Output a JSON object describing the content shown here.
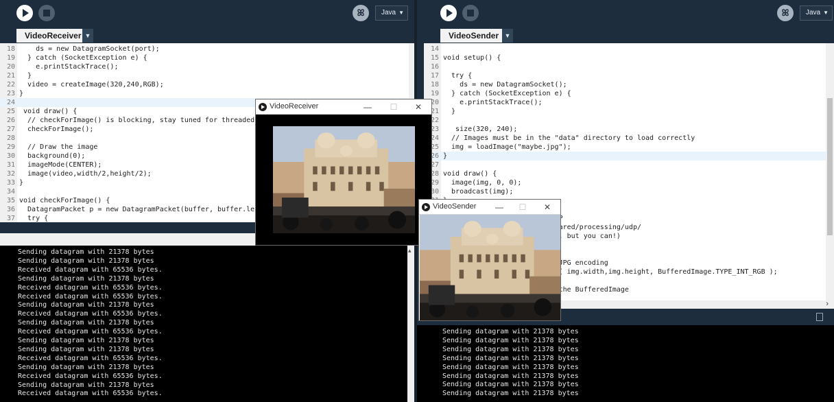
{
  "receiver": {
    "mode_label": "Java",
    "debug_icon_glyph": "ꕤ",
    "tab_label": "VideoReceiver",
    "code": [
      {
        "n": "18",
        "t": "    ds = new DatagramSocket(port);"
      },
      {
        "n": "19",
        "t": "  } catch (SocketException e) {"
      },
      {
        "n": "20",
        "t": "    e.printStackTrace();"
      },
      {
        "n": "21",
        "t": "  }"
      },
      {
        "n": "22",
        "t": "  video = createImage(320,240,RGB);"
      },
      {
        "n": "23",
        "t": "}"
      },
      {
        "n": "24",
        "t": ""
      },
      {
        "n": "25",
        "t": " void draw() {"
      },
      {
        "n": "26",
        "t": "  // checkForImage() is blocking, stay tuned for threaded exa"
      },
      {
        "n": "27",
        "t": "  checkForImage();"
      },
      {
        "n": "28",
        "t": ""
      },
      {
        "n": "29",
        "t": "  // Draw the image"
      },
      {
        "n": "30",
        "t": "  background(0);"
      },
      {
        "n": "31",
        "t": "  imageMode(CENTER);"
      },
      {
        "n": "32",
        "t": "  image(video,width/2,height/2);"
      },
      {
        "n": "33",
        "t": "}"
      },
      {
        "n": "34",
        "t": ""
      },
      {
        "n": "35",
        "t": "void checkForImage() {"
      },
      {
        "n": "36",
        "t": "  DatagramPacket p = new DatagramPacket(buffer, buffer.length"
      },
      {
        "n": "37",
        "t": "  try {"
      }
    ],
    "console": [
      "Sending datagram with 21378 bytes",
      "Sending datagram with 21378 bytes",
      "Received datagram with 65536 bytes.",
      "Sending datagram with 21378 bytes",
      "Received datagram with 65536 bytes.",
      "Received datagram with 65536 bytes.",
      "Sending datagram with 21378 bytes",
      "Received datagram with 65536 bytes.",
      "Sending datagram with 21378 bytes",
      "Received datagram with 65536 bytes.",
      "Sending datagram with 21378 bytes",
      "Sending datagram with 21378 bytes",
      "Received datagram with 65536 bytes.",
      "Sending datagram with 21378 bytes",
      "Received datagram with 65536 bytes.",
      "Sending datagram with 21378 bytes",
      "Received datagram with 65536 bytes."
    ]
  },
  "sender": {
    "mode_label": "Java",
    "debug_icon_glyph": "ꕤ",
    "tab_label": "VideoSender",
    "code": [
      {
        "n": "14",
        "t": ""
      },
      {
        "n": "15",
        "t": "void setup() {"
      },
      {
        "n": "16",
        "t": ""
      },
      {
        "n": "17",
        "t": "  try {"
      },
      {
        "n": "18",
        "t": "    ds = new DatagramSocket();"
      },
      {
        "n": "19",
        "t": "  } catch (SocketException e) {"
      },
      {
        "n": "20",
        "t": "    e.printStackTrace();"
      },
      {
        "n": "21",
        "t": "  }"
      },
      {
        "n": "22",
        "t": ""
      },
      {
        "n": "23",
        "t": "   size(320, 240);"
      },
      {
        "n": "24",
        "t": "  // Images must be in the \"data\" directory to load correctly"
      },
      {
        "n": "25",
        "t": "  img = loadImage(\"maybe.jpg\");"
      },
      {
        "n": "26",
        "t": "}"
      },
      {
        "n": "27",
        "t": ""
      },
      {
        "n": "28",
        "t": "void draw() {"
      },
      {
        "n": "29",
        "t": "  image(img, 0, 0);"
      },
      {
        "n": "30",
        "t": "  broadcast(img);"
      },
      {
        "n": "31",
        "t": "}"
      },
      {
        "n": "",
        "t": ""
      },
      {
        "n": "",
        "t": "                  ge over UDP"
      },
      {
        "n": "",
        "t": "                  baa.net/shared/processing/udp/"
      },
      {
        "n": "",
        "t": "                  he library, but you can!)"
      },
      {
        "n": "",
        "t": ""
      },
      {
        "n": "",
        "t": ""
      },
      {
        "n": "",
        "t": "                  to do the JPG encoding"
      },
      {
        "n": "",
        "t": "                  feredImage( img.width,img.height, BufferedImage.TYPE_INT_RGB );"
      },
      {
        "n": "",
        "t": ""
      },
      {
        "n": "",
        "t": "                  lFrame to the BufferedImage"
      }
    ],
    "console": [
      "Sending datagram with 21378 bytes",
      "Sending datagram with 21378 bytes",
      "Sending datagram with 21378 bytes",
      "Sending datagram with 21378 bytes",
      "Sending datagram with 21378 bytes",
      "Sending datagram with 21378 bytes",
      "Sending datagram with 21378 bytes",
      "Sending datagram with 21378 bytes"
    ]
  },
  "receiver_window": {
    "title": "VideoReceiver",
    "minimize": "—",
    "maximize": "☐",
    "close": "✕"
  },
  "sender_window": {
    "title": "VideoSender",
    "minimize": "—",
    "maximize": "☐",
    "close": "✕"
  },
  "icons": {
    "play": "play-icon",
    "stop": "stop-icon",
    "debug": "debugger-icon",
    "caret": "▼",
    "scroll_up": "▴",
    "scroll_right": "›",
    "console_toggle": "console-icon"
  },
  "colors": {
    "ide_background": "#1e2d3d",
    "keyword": "#33997e",
    "function": "#006699",
    "builtin": "#e2661a",
    "comment": "#666666"
  }
}
